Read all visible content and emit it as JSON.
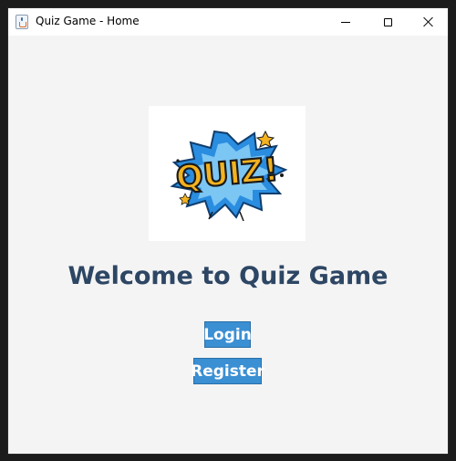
{
  "window": {
    "title": "Quiz Game - Home"
  },
  "main": {
    "logo_text": "QUIZ!",
    "heading": "Welcome to Quiz Game",
    "login_label": "Login",
    "register_label": "Register"
  },
  "colors": {
    "heading": "#2d4664",
    "button_bg": "#3b8fd3",
    "button_text": "#ffffff",
    "background": "#f4f4f4",
    "logo_burst": "#2a8de0",
    "logo_letters": "#f3b21f"
  }
}
